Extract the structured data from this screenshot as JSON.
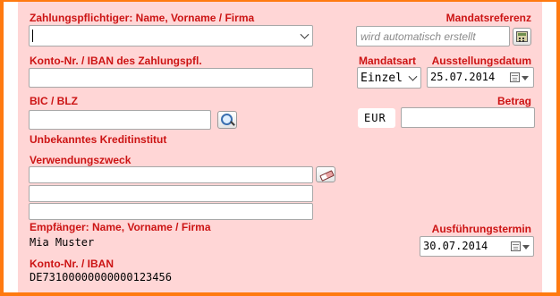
{
  "colors": {
    "label": "#cc1414",
    "panel_bg": "#ffd6d6",
    "frame": "#ff7a10"
  },
  "payer": {
    "label": "Zahlungspflichtiger: Name, Vorname / Firma",
    "value": ""
  },
  "mandate_reference": {
    "label": "Mandatsreferenz",
    "placeholder": "wird automatisch erstellt",
    "icon": "calculator-icon"
  },
  "payer_account": {
    "label": "Konto-Nr. / IBAN des Zahlungspfl.",
    "value": ""
  },
  "mandate_type": {
    "label": "Mandatsart",
    "value": "Einzel"
  },
  "issue_date": {
    "label": "Ausstellungsdatum",
    "value": "25.07.2014",
    "icon": "calendar-icon"
  },
  "bic": {
    "label": "BIC / BLZ",
    "value": "",
    "icon": "magnifier-icon",
    "status": "Unbekanntes Kreditinstitut"
  },
  "amount": {
    "label": "Betrag",
    "currency": "EUR",
    "value": ""
  },
  "purpose": {
    "label": "Verwendungszweck",
    "lines": [
      "",
      "",
      ""
    ],
    "icon": "eraser-icon"
  },
  "recipient": {
    "label": "Empfänger: Name, Vorname / Firma",
    "value": "Mia Muster"
  },
  "recipient_account": {
    "label": "Konto-Nr. / IBAN",
    "value": "DE73100000000000123456"
  },
  "execution_date": {
    "label": "Ausführungstermin",
    "value": "30.07.2014",
    "icon": "calendar-icon"
  }
}
